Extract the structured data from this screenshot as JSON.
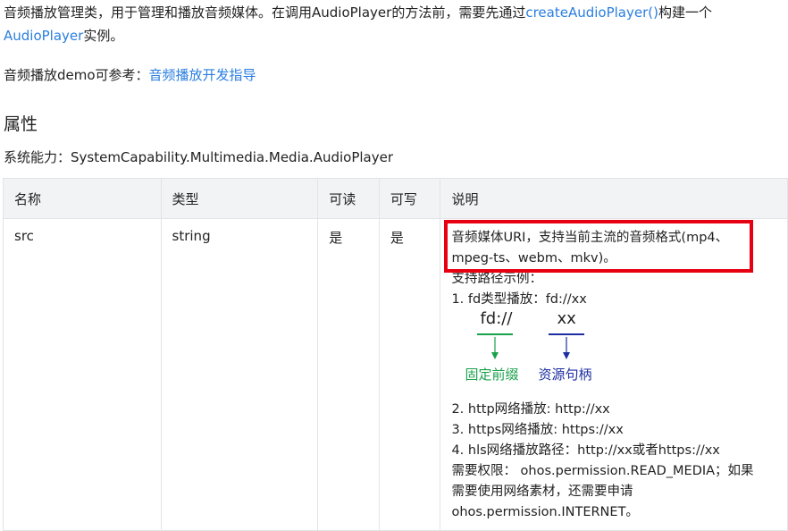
{
  "intro": {
    "text1": "音频播放管理类，用于管理和播放音频媒体。在调用AudioPlayer的方法前，需要先通过",
    "link1": "createAudioPlayer()",
    "text2": "构建一个",
    "link2": "AudioPlayer",
    "text3": "实例。"
  },
  "demo": {
    "label": "音频播放demo可参考：",
    "link": "音频播放开发指导"
  },
  "section_title": "属性",
  "capability": "系统能力：SystemCapability.Multimedia.Media.AudioPlayer",
  "table": {
    "headers": [
      "名称",
      "类型",
      "可读",
      "可写",
      "说明"
    ],
    "row": {
      "name": "src",
      "type": "string",
      "readable": "是",
      "writable": "是",
      "desc_highlight_1": "音频媒体URI，支持当前主流的音频格式(mp4、",
      "desc_highlight_2": "mpeg-ts、webm、mkv)。",
      "examples_title": "支持路径示例：",
      "example1": "1. fd类型播放：fd://xx",
      "diagram": {
        "left_text": "fd://",
        "right_text": "xx",
        "left_label": "固定前缀",
        "right_label": "资源句柄",
        "left_color": "#1aa14b",
        "right_color": "#1d2ea0"
      },
      "example2": "2. http网络播放: http://xx",
      "example3": "3. https网络播放: https://xx",
      "example4": "4. hls网络播放路径：http://xx或者https://xx",
      "perm1": "需要权限： ohos.permission.READ_MEDIA；如果",
      "perm2": "需要使用网络素材，还需要申请",
      "perm3": "ohos.permission.INTERNET。"
    }
  },
  "colors": {
    "link": "#2a7ee0",
    "highlight_border": "#e60012",
    "header_bg": "#f1f3f5"
  }
}
